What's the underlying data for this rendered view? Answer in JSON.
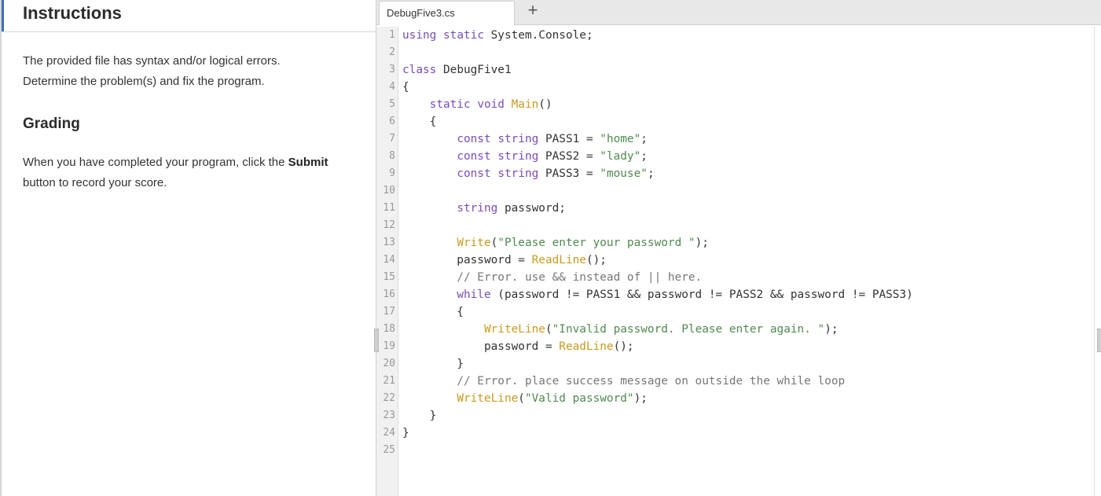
{
  "instructions": {
    "title": "Instructions",
    "para1_line1": "The provided file has syntax and/or logical errors.",
    "para1_line2": "Determine the problem(s) and fix the program.",
    "grading_title": "Grading",
    "para2_pre": "When you have completed your program, click the ",
    "para2_bold": "Submit",
    "para2_post": "button to record your score."
  },
  "editor": {
    "tab_label": "DebugFive3.cs",
    "add_tab": "+",
    "line_numbers": [
      "1",
      "2",
      "3",
      "4",
      "5",
      "6",
      "7",
      "8",
      "9",
      "10",
      "11",
      "12",
      "13",
      "14",
      "15",
      "16",
      "17",
      "18",
      "19",
      "20",
      "21",
      "22",
      "23",
      "24",
      "25"
    ],
    "code_lines": [
      "using static System.Console;",
      "",
      "class DebugFive1",
      "{",
      "    static void Main()",
      "    {",
      "        const string PASS1 = \"home\";",
      "        const string PASS2 = \"lady\";",
      "        const string PASS3 = \"mouse\";",
      "",
      "        string password;",
      "",
      "        Write(\"Please enter your password \");",
      "        password = ReadLine();",
      "        // Error. use && instead of || here.",
      "        while (password != PASS1 && password != PASS2 && password != PASS3)",
      "        {",
      "            WriteLine(\"Invalid password. Please enter again. \");",
      "            password = ReadLine();",
      "        }",
      "        // Error. place success message on outside the while loop",
      "        WriteLine(\"Valid password\");",
      "    }",
      "}",
      ""
    ]
  },
  "colors": {
    "keyword": "#7a4db8",
    "function": "#c89a1e",
    "string": "#4f8a4f",
    "comment": "#777777",
    "accent": "#3d6fb5"
  }
}
